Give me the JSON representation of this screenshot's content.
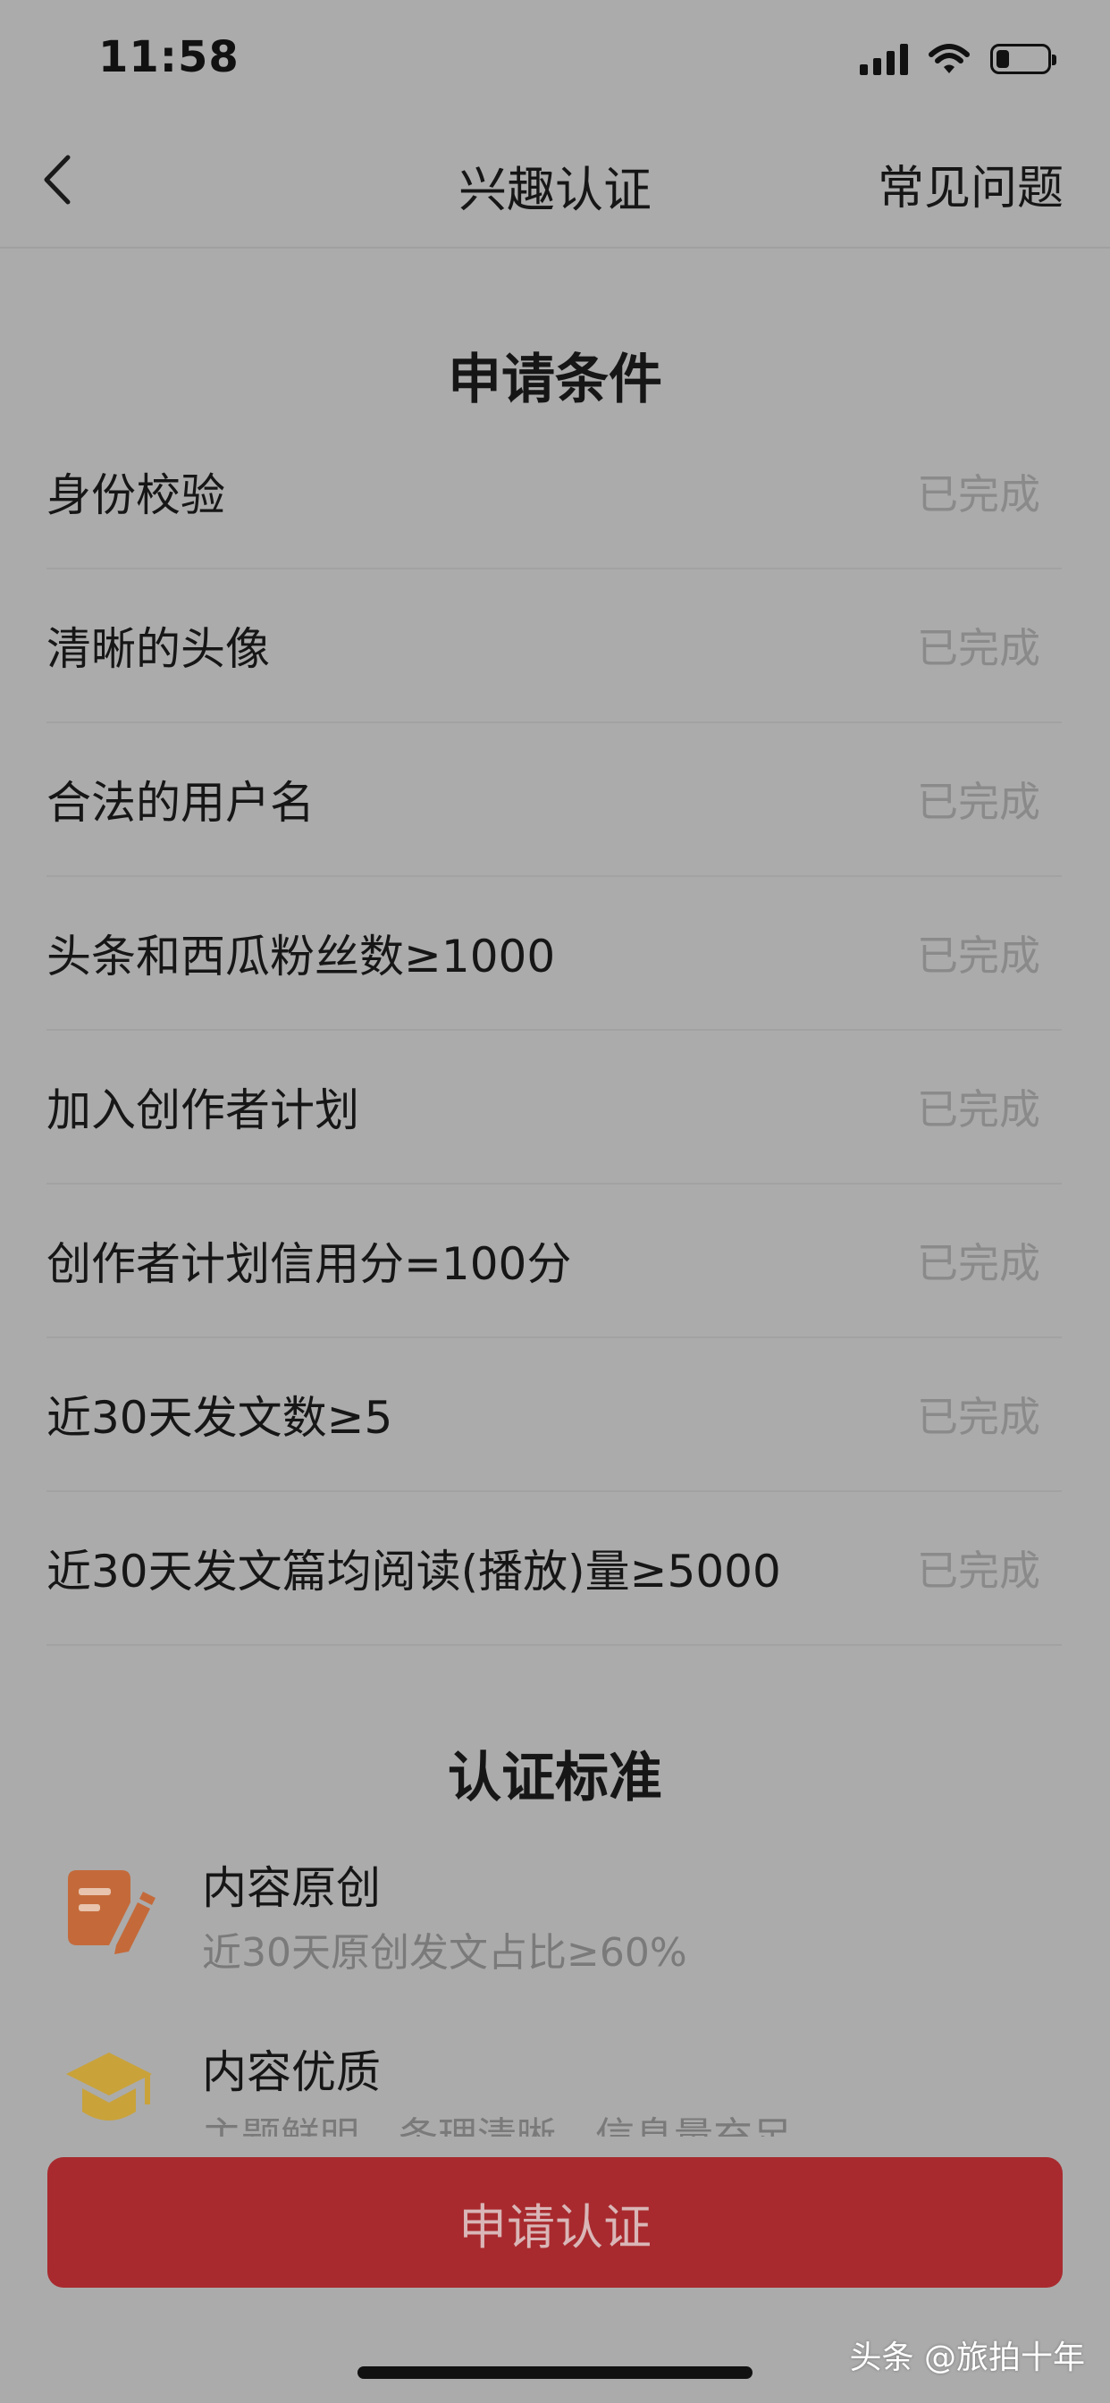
{
  "status_bar": {
    "time": "11:58",
    "battery_level": 0.25
  },
  "nav": {
    "title": "兴趣认证",
    "faq_label": "常见问题"
  },
  "requirements": {
    "title": "申请条件",
    "items": [
      {
        "label": "身份校验",
        "status": "已完成"
      },
      {
        "label": "清晰的头像",
        "status": "已完成"
      },
      {
        "label": "合法的用户名",
        "status": "已完成"
      },
      {
        "label": "头条和西瓜粉丝数≥1000",
        "status": "已完成"
      },
      {
        "label": "加入创作者计划",
        "status": "已完成"
      },
      {
        "label": "创作者计划信用分=100分",
        "status": "已完成"
      },
      {
        "label": "近30天发文数≥5",
        "status": "已完成"
      },
      {
        "label": "近30天发文篇均阅读(播放)量≥5000",
        "status": "已完成"
      }
    ]
  },
  "standards": {
    "title": "认证标准",
    "items": [
      {
        "title": "内容原创",
        "desc": "近30天原创发文占比≥60%",
        "icon": "edit-document-icon"
      },
      {
        "title": "内容优质",
        "desc": "主题鲜明，条理清晰，信息量充足",
        "icon": "graduation-cap-icon"
      }
    ]
  },
  "apply_button": {
    "label": "申请认证"
  },
  "watermark": "头条 @旅拍十年",
  "colors": {
    "background": "#ababab",
    "primary": "#a82a2e",
    "icon_orange": "#c46a3a",
    "icon_gold": "#c9a23a"
  }
}
